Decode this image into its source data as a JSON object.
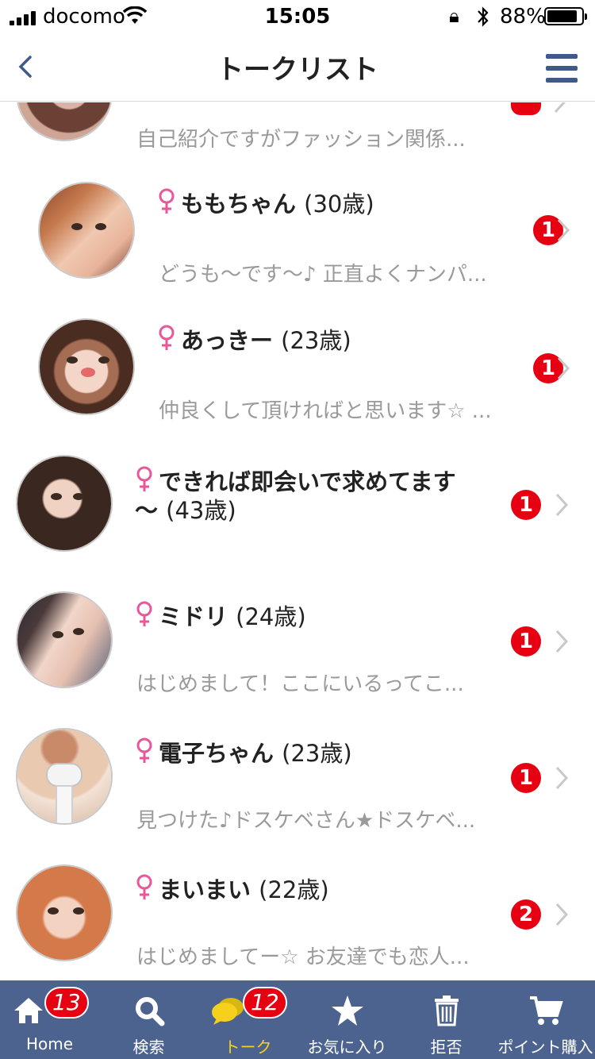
{
  "status_bar": {
    "carrier": "docomo",
    "time": "15:05",
    "battery": "88%",
    "battery_level": 0.88
  },
  "nav": {
    "title": "トークリスト",
    "back_icon": "chevron-left-icon",
    "menu_icon": "hamburger-menu-icon"
  },
  "colors": {
    "accent": "#4d638f",
    "badge": "#e60012",
    "female": "#e8579a",
    "active_tab": "#f5d11e"
  },
  "list": {
    "items": [
      {
        "name": "",
        "age": "",
        "preview": "自己紹介ですがファッション関係...",
        "unread": ""
      },
      {
        "name": "ももちゃん",
        "age": "(30歳)",
        "preview": "どうも〜です〜♪ 正直よくナンパ...",
        "unread": "1"
      },
      {
        "name": "あっきー",
        "age": "(23歳)",
        "preview": "仲良くして頂ければと思います☆ ...",
        "unread": "1"
      },
      {
        "name": "できれば即会いで求めてます",
        "name_line2": "〜",
        "age": "(43歳)",
        "preview": "",
        "unread": "1"
      },
      {
        "name": "ミドリ",
        "age": "(24歳)",
        "preview": "はじめまして！ここにいるってこ...",
        "unread": "1"
      },
      {
        "name": "電子ちゃん",
        "age": "(23歳)",
        "preview": "見つけた♪ドスケベさん★ドスケベ...",
        "unread": "1"
      },
      {
        "name": "まいまい",
        "age": "(22歳)",
        "preview": "はじめましてー☆ お友達でも恋人...",
        "unread": "2"
      }
    ]
  },
  "tabbar": {
    "tabs": [
      {
        "label": "Home",
        "icon": "home-icon",
        "badge": "13"
      },
      {
        "label": "検索",
        "icon": "search-icon",
        "badge": ""
      },
      {
        "label": "トーク",
        "icon": "chat-bubble-icon",
        "badge": "12",
        "active": true
      },
      {
        "label": "お気に入り",
        "icon": "star-icon",
        "badge": ""
      },
      {
        "label": "拒否",
        "icon": "trash-icon",
        "badge": ""
      },
      {
        "label": "ポイント購入",
        "icon": "cart-icon",
        "badge": ""
      }
    ]
  }
}
